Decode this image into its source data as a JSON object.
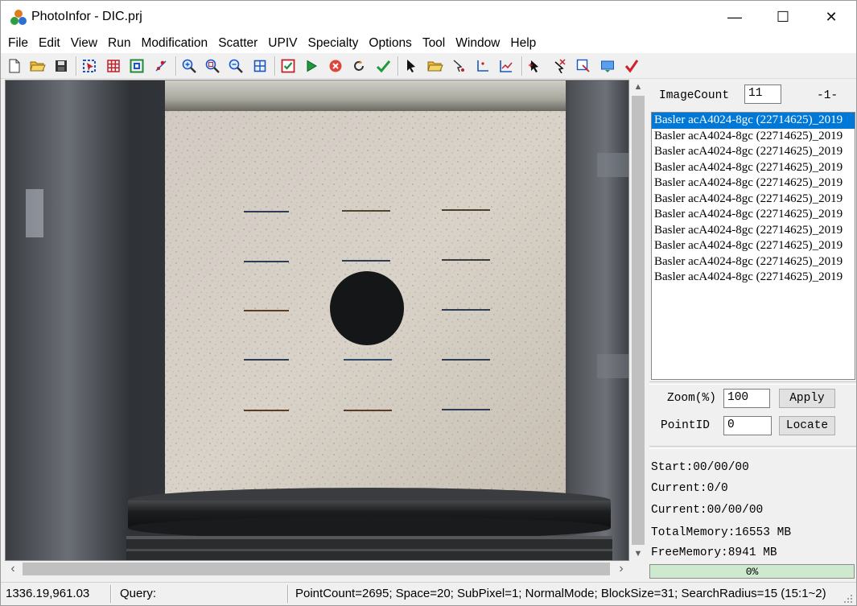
{
  "window": {
    "title": "PhotoInfor - DIC.prj",
    "minimize": "—",
    "maximize": "☐",
    "close": "✕"
  },
  "menu": [
    "File",
    "Edit",
    "View",
    "Run",
    "Modification",
    "Scatter",
    "UPIV",
    "Specialty",
    "Options",
    "Tool",
    "Window",
    "Help"
  ],
  "toolbar": {
    "icons": [
      "new-file-icon",
      "open-folder-icon",
      "save-icon",
      "select-region-icon",
      "grid-icon",
      "fit-frame-icon",
      "point-icon",
      "zoom-in-icon",
      "zoom-region-icon",
      "zoom-out-icon",
      "zoom-fit-icon",
      "check-box-icon",
      "run-icon",
      "stop-icon",
      "refresh-icon",
      "confirm-icon",
      "pointer-icon",
      "open-icon",
      "vector-icon",
      "axis-icon",
      "chart-icon",
      "cursor-icon",
      "tool-icon",
      "export-icon",
      "report-icon",
      "red-check-icon"
    ]
  },
  "panel": {
    "image_count_label": "ImageCount",
    "image_count_value": "11",
    "page_indicator": "-1-",
    "images": [
      "Basler acA4024-8gc (22714625)_2019",
      "Basler acA4024-8gc (22714625)_2019",
      "Basler acA4024-8gc (22714625)_2019",
      "Basler acA4024-8gc (22714625)_2019",
      "Basler acA4024-8gc (22714625)_2019",
      "Basler acA4024-8gc (22714625)_2019",
      "Basler acA4024-8gc (22714625)_2019",
      "Basler acA4024-8gc (22714625)_2019",
      "Basler acA4024-8gc (22714625)_2019",
      "Basler acA4024-8gc (22714625)_2019",
      "Basler acA4024-8gc (22714625)_2019"
    ],
    "selected_index": 0,
    "zoom_label": "Zoom(%)",
    "zoom_value": "100",
    "apply_label": "Apply",
    "point_id_label": "PointID",
    "point_id_value": "0",
    "locate_label": "Locate",
    "start": "Start:00/00/00",
    "current_count": "Current:0/0",
    "current_time": "Current:00/00/00",
    "total_memory": "TotalMemory:16553 MB",
    "free_memory": "FreeMemory:8941 MB",
    "progress": "0%"
  },
  "status": {
    "coords": "1336.19,961.03",
    "query": "Query:",
    "info": "PointCount=2695; Space=20; SubPixel=1;  NormalMode; BlockSize=31; SearchRadius=15 (15:1~2)"
  },
  "colors": {
    "selection": "#0078d7",
    "progress_bg": "#cfe9cf"
  }
}
